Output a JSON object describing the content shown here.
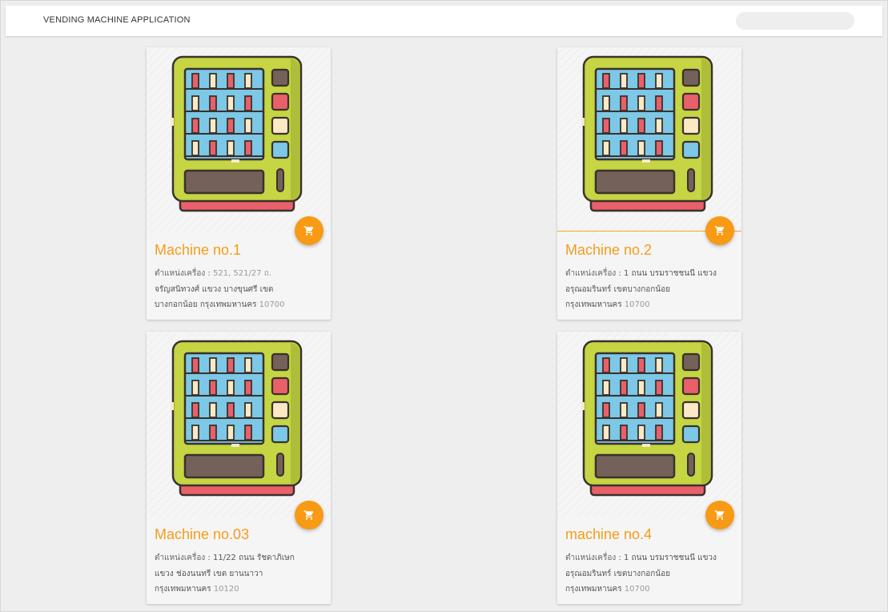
{
  "app": {
    "title": "VENDING MACHINE APPLICATION"
  },
  "colors": {
    "accent": "#f59c1a",
    "fab": "#f89a14",
    "machine_body": "#c5d543",
    "machine_bottom": "#e9606a",
    "screen": "#7cc8e6",
    "outline": "#3a312c"
  },
  "icons": {
    "cart": "shopping-cart-icon",
    "machine": "vending-machine-illustration"
  },
  "machines": [
    {
      "name": "Machine no.1",
      "address_label": "ตำแหน่งเครื่อง :",
      "address_line1": "521, 521/27 ถ.",
      "address_line2": "จรัญสนิทวงศ์ แขวง บางขุนศรี เขต",
      "address_line3a": "บางกอกน้อย กรุงเทพมหานคร",
      "address_line3b": "10700"
    },
    {
      "name": "Machine no.2",
      "address_label": "ตำแหน่งเครื่อง :",
      "address_line1": "1 ถนน บรมราชชนนี แขวง",
      "address_line2": "อรุณอมรินทร์ เขตบางกอกน้อย",
      "address_line3a": "กรุงเทพมหานคร",
      "address_line3b": "10700"
    },
    {
      "name": "Machine no.03",
      "address_label": "ตำแหน่งเครื่อง :",
      "address_line1": "11/22 ถนน รัชดาภิเษก",
      "address_line2": "แขวง ช่องนนทรี เขต ยานนาวา",
      "address_line3a": "กรุงเทพมหานคร",
      "address_line3b": "10120"
    },
    {
      "name": "machine no.4",
      "address_label": "ตำแหน่งเครื่อง :",
      "address_line1": "1 ถนน บรมราชชนนี แขวง",
      "address_line2": "อรุณอมรินทร์ เขตบางกอกน้อย",
      "address_line3a": "กรุงเทพมหานคร",
      "address_line3b": "10700"
    }
  ]
}
